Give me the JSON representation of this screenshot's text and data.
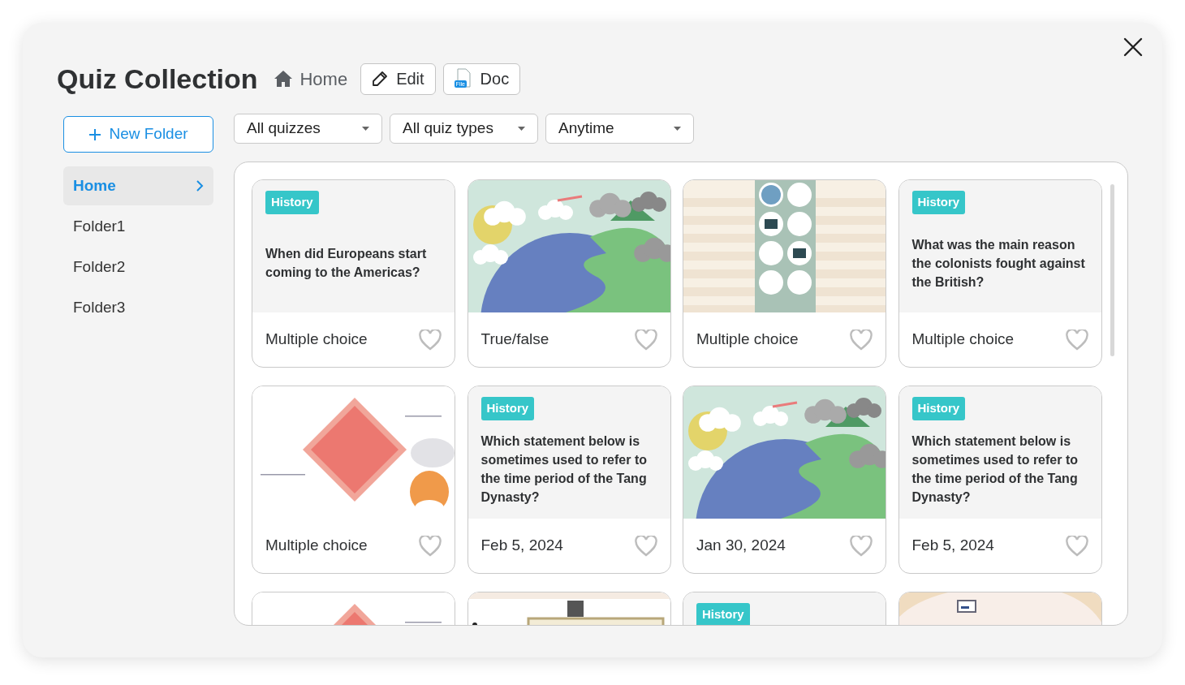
{
  "title": "Quiz Collection",
  "breadcrumb": "Home",
  "header_buttons": [
    {
      "kind": "edit",
      "label": "Edit"
    },
    {
      "kind": "doc",
      "label": "Doc",
      "badge": "File"
    }
  ],
  "new_folder": "New Folder",
  "folders": [
    {
      "label": "Home",
      "selected": true
    },
    {
      "label": "Folder1",
      "selected": false
    },
    {
      "label": "Folder2",
      "selected": false
    },
    {
      "label": "Folder3",
      "selected": false
    }
  ],
  "filters": [
    "All quizzes",
    "All quiz types",
    "Anytime"
  ],
  "cards": [
    {
      "kind": "question",
      "tag": "History",
      "question": "When did Europeans start coming to the Americas?",
      "footer": "Multiple choice",
      "favorite": false
    },
    {
      "kind": "picture",
      "footer": "True/false",
      "favorite": false
    },
    {
      "kind": "picture",
      "footer": "Multiple choice",
      "favorite": false
    },
    {
      "kind": "question",
      "tag": "History",
      "question": "What was the main reason the colonists fought against the British?",
      "footer": "Multiple choice",
      "favorite": false
    },
    {
      "kind": "picture",
      "footer": "Multiple choice",
      "favorite": false
    },
    {
      "kind": "question",
      "tag": "History",
      "question": "Which statement below is sometimes used to refer to the time period of the Tang Dynasty?",
      "footer": "Feb 5, 2024",
      "favorite": false
    },
    {
      "kind": "picture",
      "footer": "Jan 30, 2024",
      "favorite": false
    },
    {
      "kind": "question",
      "tag": "History",
      "question": "Which statement below is sometimes used to refer to the time period of the Tang Dynasty?",
      "footer": "Feb 5, 2024",
      "favorite": false
    },
    {
      "kind": "picture"
    },
    {
      "kind": "picture"
    },
    {
      "kind": "question",
      "tag": "History"
    },
    {
      "kind": "picture"
    }
  ]
}
